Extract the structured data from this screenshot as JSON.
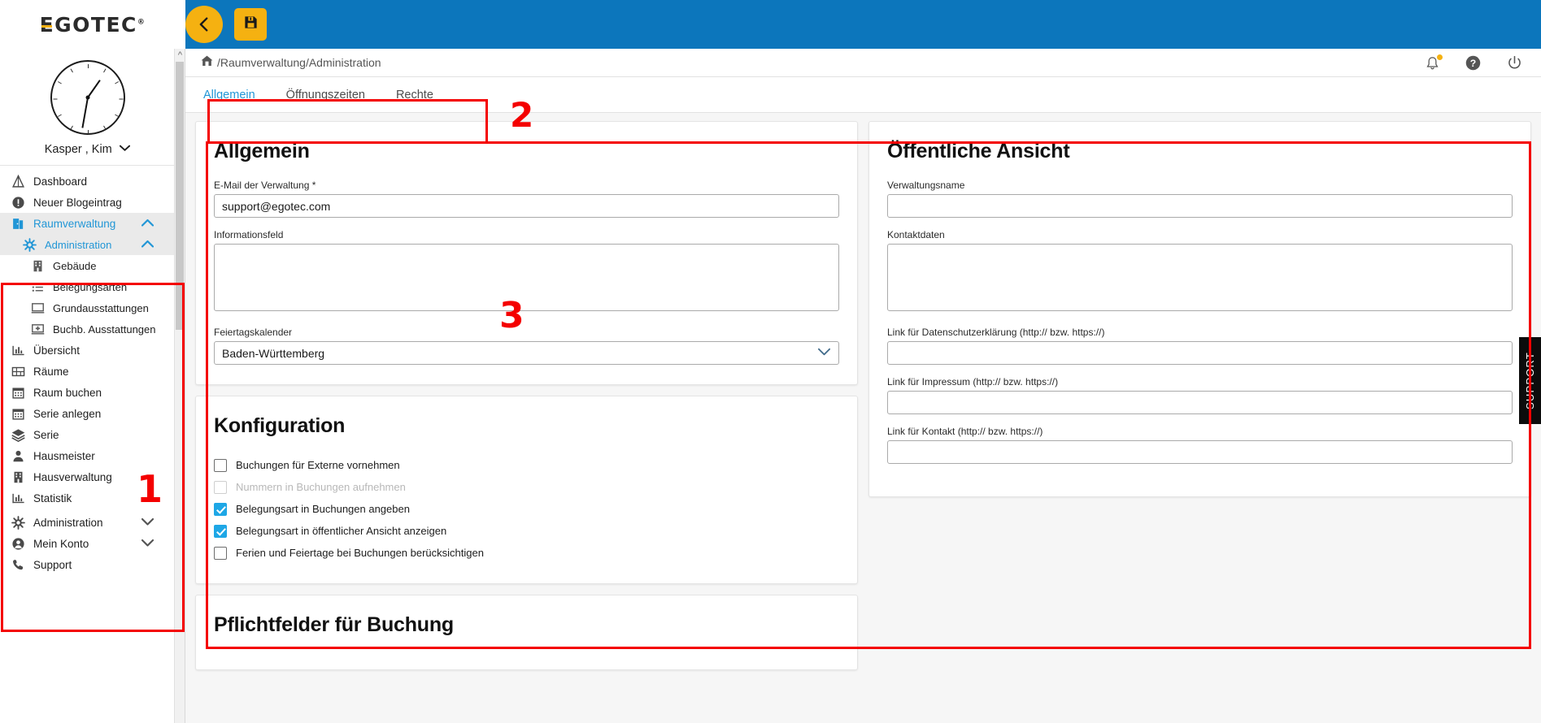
{
  "brand": {
    "logo": "EGOTEC",
    "registered": "®"
  },
  "topbar": {
    "back_label": "back-arrow",
    "save_label": "save"
  },
  "sidebar": {
    "profile": {
      "name": "Kasper , Kim",
      "clock_icon": "clock-icon"
    },
    "items": [
      {
        "label": "Dashboard",
        "icon": "dashboard-icon",
        "level": 0,
        "active": false,
        "chevron": ""
      },
      {
        "label": "Neuer Blogeintrag",
        "icon": "info-icon",
        "level": 0,
        "active": false,
        "chevron": ""
      },
      {
        "label": "Raumverwaltung",
        "icon": "door-icon",
        "level": 0,
        "active": true,
        "chevron": "up"
      },
      {
        "label": "Administration",
        "icon": "gear-icon",
        "level": 1,
        "active": true,
        "chevron": "up"
      },
      {
        "label": "Gebäude",
        "icon": "building-icon",
        "level": 2,
        "active": false,
        "chevron": ""
      },
      {
        "label": "Belegungsarten",
        "icon": "list-icon",
        "level": 2,
        "active": false,
        "chevron": ""
      },
      {
        "label": "Grundausstattungen",
        "icon": "monitor-icon",
        "level": 2,
        "active": false,
        "chevron": ""
      },
      {
        "label": "Buchb. Ausstattungen",
        "icon": "monitor-plus-icon",
        "level": 2,
        "active": false,
        "chevron": ""
      },
      {
        "label": "Übersicht",
        "icon": "chart-icon",
        "level": 0,
        "active": false,
        "chevron": ""
      },
      {
        "label": "Räume",
        "icon": "rooms-icon",
        "level": 0,
        "active": false,
        "chevron": ""
      },
      {
        "label": "Raum buchen",
        "icon": "calendar-icon",
        "level": 0,
        "active": false,
        "chevron": ""
      },
      {
        "label": "Serie anlegen",
        "icon": "calendar-icon",
        "level": 0,
        "active": false,
        "chevron": ""
      },
      {
        "label": "Serie",
        "icon": "layers-icon",
        "level": 0,
        "active": false,
        "chevron": ""
      },
      {
        "label": "Hausmeister",
        "icon": "person-icon",
        "level": 0,
        "active": false,
        "chevron": ""
      },
      {
        "label": "Hausverwaltung",
        "icon": "building-icon",
        "level": 0,
        "active": false,
        "chevron": ""
      },
      {
        "label": "Statistik",
        "icon": "chart-icon",
        "level": 0,
        "active": false,
        "chevron": ""
      },
      {
        "label": "Administration",
        "icon": "gear-icon",
        "level": 0,
        "active": false,
        "chevron": "down"
      },
      {
        "label": "Mein Konto",
        "icon": "account-icon",
        "level": 0,
        "active": false,
        "chevron": "down"
      },
      {
        "label": "Support",
        "icon": "phone-icon",
        "level": 0,
        "active": false,
        "chevron": ""
      }
    ]
  },
  "breadcrumb": {
    "home_icon": "home-icon",
    "path": "/Raumverwaltung/Administration",
    "icons": [
      {
        "name": "bell-icon",
        "badge": true
      },
      {
        "name": "help-icon",
        "badge": false
      },
      {
        "name": "power-icon",
        "badge": false
      }
    ]
  },
  "tabs": [
    {
      "label": "Allgemein",
      "active": true
    },
    {
      "label": "Öffnungszeiten",
      "active": false
    },
    {
      "label": "Rechte",
      "active": false
    }
  ],
  "allgemein": {
    "title": "Allgemein",
    "email_label": "E-Mail der Verwaltung  *",
    "email_value": "support@egotec.com",
    "info_label": "Informationsfeld",
    "info_value": "",
    "holiday_label": "Feiertagskalender",
    "holiday_value": "Baden-Württemberg"
  },
  "konfiguration": {
    "title": "Konfiguration",
    "checkboxes": [
      {
        "label": "Buchungen für Externe vornehmen",
        "checked": false,
        "disabled": false
      },
      {
        "label": "Nummern in Buchungen aufnehmen",
        "checked": false,
        "disabled": true
      },
      {
        "label": "Belegungsart in Buchungen angeben",
        "checked": true,
        "disabled": false
      },
      {
        "label": "Belegungsart in öffentlicher Ansicht anzeigen",
        "checked": true,
        "disabled": false
      },
      {
        "label": "Ferien und Feiertage bei Buchungen berücksichtigen",
        "checked": false,
        "disabled": false
      }
    ]
  },
  "pflichtfelder": {
    "title": "Pflichtfelder für Buchung"
  },
  "oeffentliche_ansicht": {
    "title": "Öffentliche Ansicht",
    "fields": [
      {
        "label": "Verwaltungsname",
        "value": "",
        "type": "text"
      },
      {
        "label": "Kontaktdaten",
        "value": "",
        "type": "textarea"
      },
      {
        "label": "Link für Datenschutzerklärung (http:// bzw. https://)",
        "value": "",
        "type": "text"
      },
      {
        "label": "Link für Impressum (http:// bzw. https://)",
        "value": "",
        "type": "text"
      },
      {
        "label": "Link für Kontakt (http:// bzw. https://)",
        "value": "",
        "type": "text"
      }
    ]
  },
  "support_tab": {
    "label": "SUPPORT"
  },
  "annotations": [
    {
      "number": "1"
    },
    {
      "number": "2"
    },
    {
      "number": "3"
    }
  ],
  "colors": {
    "brand_blue": "#0c76bc",
    "accent_yellow": "#f5b111",
    "link_blue": "#2196d6",
    "annotation_red": "#f40000",
    "checkbox_blue": "#1ea7e6"
  }
}
